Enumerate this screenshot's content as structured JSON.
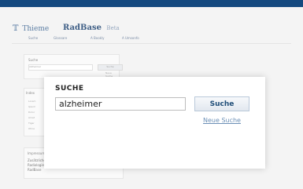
{
  "header": {
    "logo": "Thieme",
    "brand": "RadBase",
    "brand_sub": "Beta"
  },
  "nav": {
    "items": [
      "Suche",
      "Glossare",
      "A Bookly",
      "A Umsonfo"
    ]
  },
  "search_panel": {
    "title": "Suche",
    "input_value": "Alzheimer",
    "button_label": "Suche",
    "link": "Neue Suche"
  },
  "left_panel": {
    "title": "Index",
    "items": [
      "Lorem",
      "Ipsum",
      "Dolor",
      "Amet",
      "Tiger",
      "Ohne"
    ]
  },
  "info_panel": {
    "title": "Impressum",
    "text_lines": [
      "Zusätzliche Informationen finden Sie über die",
      "Radiologie Startseite Thieme Suchfunktion",
      "RadBase"
    ]
  },
  "popup": {
    "title": "SUCHE",
    "input_value": "alzheimer",
    "button_label": "Suche",
    "link_label": "Neue Suche"
  }
}
